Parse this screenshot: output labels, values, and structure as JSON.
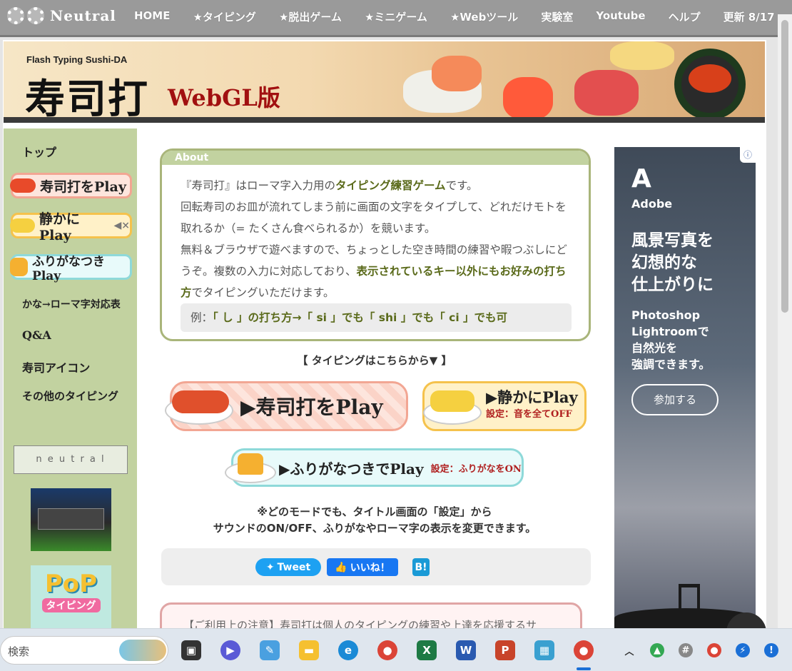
{
  "topnav": {
    "logo_text": "Neutral",
    "items": [
      "HOME",
      "★タイピング",
      "★脱出ゲーム",
      "★ミニゲーム",
      "★Webツール",
      "実験室",
      "Youtube",
      "ヘルプ",
      "更新 8/17"
    ]
  },
  "banner": {
    "subtitle": "Flash Typing Sushi-DA",
    "title": "寿司打",
    "edition": "WebGL版"
  },
  "sidebar": {
    "top": "トップ",
    "buttons": [
      "寿司打をPlay",
      "静かにPlay",
      "ふりがなつきPlay"
    ],
    "links": [
      "かな→ローマ字対応表",
      "Q&A",
      "寿司アイコン",
      "その他のタイピング"
    ],
    "neutral_banner": "n e u t r a l",
    "pop_banner_1": "PoP",
    "pop_banner_2": "タイピング"
  },
  "about": {
    "heading": "About",
    "line1_a": "『寿司打』はローマ字入力用の",
    "line1_b": "タイピング練習ゲーム",
    "line1_c": "です。",
    "line2": "回転寿司のお皿が流れてしまう前に画面の文字をタイプして、どれだけモトを取れるか（= たくさん食べられるか）を競います。",
    "line3_a": "無料＆ブラウザで遊べますので、ちょっとした空き時間の練習や暇つぶしにどうぞ。複数の入力に対応しており、",
    "line3_b": "表示されているキー以外にもお好みの打ち方",
    "line3_c": "でタイピングいただけます。",
    "example_a": "例：",
    "example_b": "「 し 」の打ち方→「 si 」でも「 shi 」でも「 ci 」でも可"
  },
  "typing_heading": "【 タイピングはこちらから▼ 】",
  "play": {
    "main": "▶寿司打をPlay",
    "quiet": "▶静かにPlay",
    "quiet_sub": "設定：音を全てOFF",
    "furigana": "▶ふりがなつきでPlay",
    "furigana_sub": "設定：ふりがなをON"
  },
  "note": {
    "line1": "※どのモードでも、タイトル画面の「設定」から",
    "line2": "サウンドのON/OFF、ふりがなやローマ字の表示を変更できます。"
  },
  "share": {
    "tweet": "Tweet",
    "like": "いいね！",
    "hatena": "B!"
  },
  "caution_text": "【ご利用上の注意】寿司打は個人のタイピングの練習や上達を応援するサ",
  "ad": {
    "brand": "Adobe",
    "headline": "風景写真を\n幻想的な\n仕上がりに",
    "sub": "Photoshop\nLightroomで\n自然光を\n強調できます。",
    "cta": "参加する"
  },
  "taskbar": {
    "search_placeholder": "検索"
  },
  "colors": {
    "nav_bg": "#9a9a9a",
    "sidebar_bg": "#c2d2a0",
    "about_border": "#a9b57a",
    "accent_text": "#5a6a1a",
    "tweet_blue": "#1da1f2",
    "like_blue": "#1877f2"
  }
}
